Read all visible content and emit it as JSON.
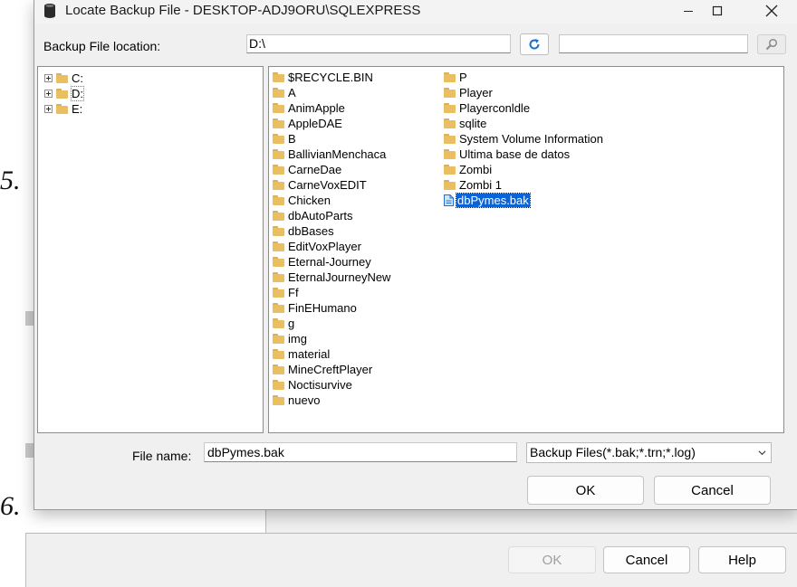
{
  "background": {
    "step_numbers": [
      "5.",
      "6."
    ],
    "buttons": {
      "ok": "OK",
      "cancel": "Cancel",
      "help": "Help"
    }
  },
  "dialog": {
    "title": "Locate Backup File - DESKTOP-ADJ9ORU\\SQLEXPRESS",
    "location_label": "Backup File location:",
    "location_value": "D:\\",
    "search_value": "",
    "tree": [
      {
        "label": "C:"
      },
      {
        "label": "D:"
      },
      {
        "label": "E:"
      }
    ],
    "files_col1": [
      "$RECYCLE.BIN",
      "A",
      "AnimApple",
      "AppleDAE",
      "B",
      "BallivianMenchaca",
      "CarneDae",
      "CarneVoxEDIT",
      "Chicken",
      "dbAutoParts",
      "dbBases",
      "EditVoxPlayer",
      "Eternal-Journey",
      "EternalJourneyNew",
      "Ff",
      "FinEHumano",
      "g",
      "img",
      "material",
      "MineCreftPlayer",
      "Noctisurvive",
      "nuevo"
    ],
    "files_col2": [
      "P",
      "Player",
      "Playerconldle",
      "sqlite",
      "System Volume Information",
      "Ultima base de datos",
      "Zombi",
      "Zombi 1"
    ],
    "selected_file": "dbPymes.bak",
    "file_name_label": "File name:",
    "file_name_value": "dbPymes.bak",
    "file_filter": "Backup Files(*.bak;*.trn;*.log)",
    "ok_label": "OK",
    "cancel_label": "Cancel"
  },
  "colors": {
    "selection": "#0a64d8",
    "folder": "#eabf62",
    "refresh_icon": "#1a6fd1"
  }
}
